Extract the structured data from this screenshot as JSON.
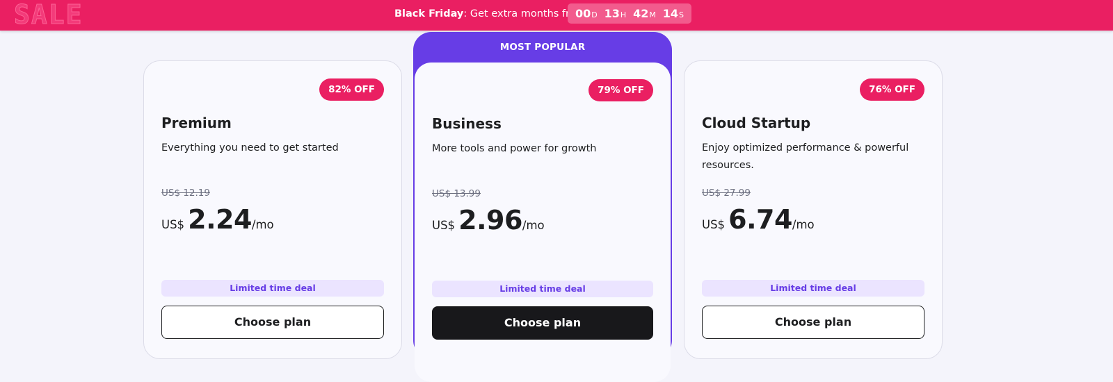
{
  "banner": {
    "sale_logo": "SALE",
    "event": "Black Friday",
    "message": ": Get extra months free",
    "countdown": [
      {
        "value": "00",
        "unit": "D"
      },
      {
        "value": "13",
        "unit": "H"
      },
      {
        "value": "42",
        "unit": "M"
      },
      {
        "value": "14",
        "unit": "S"
      }
    ]
  },
  "popular_label": "MOST POPULAR",
  "plans": [
    {
      "discount": "82% OFF",
      "name": "Premium",
      "description": "Everything you need to get started",
      "old_price": "US$ 12.19",
      "currency": "US$",
      "price": "2.24",
      "period": "/mo",
      "deal": "Limited time deal",
      "cta": "Choose plan"
    },
    {
      "discount": "79% OFF",
      "name": "Business",
      "description": "More tools and power for growth",
      "old_price": "US$ 13.99",
      "currency": "US$",
      "price": "2.96",
      "period": "/mo",
      "deal": "Limited time deal",
      "cta": "Choose plan"
    },
    {
      "discount": "76% OFF",
      "name": "Cloud Startup",
      "description": "Enjoy optimized performance & powerful resources.",
      "old_price": "US$ 27.99",
      "currency": "US$",
      "price": "6.74",
      "period": "/mo",
      "deal": "Limited time deal",
      "cta": "Choose plan"
    }
  ],
  "colors": {
    "banner": "#ea1f62",
    "accent_purple": "#673de6",
    "badge": "#ea1f62",
    "deal_bg": "#ebe4ff",
    "dark_button": "#18181b"
  }
}
